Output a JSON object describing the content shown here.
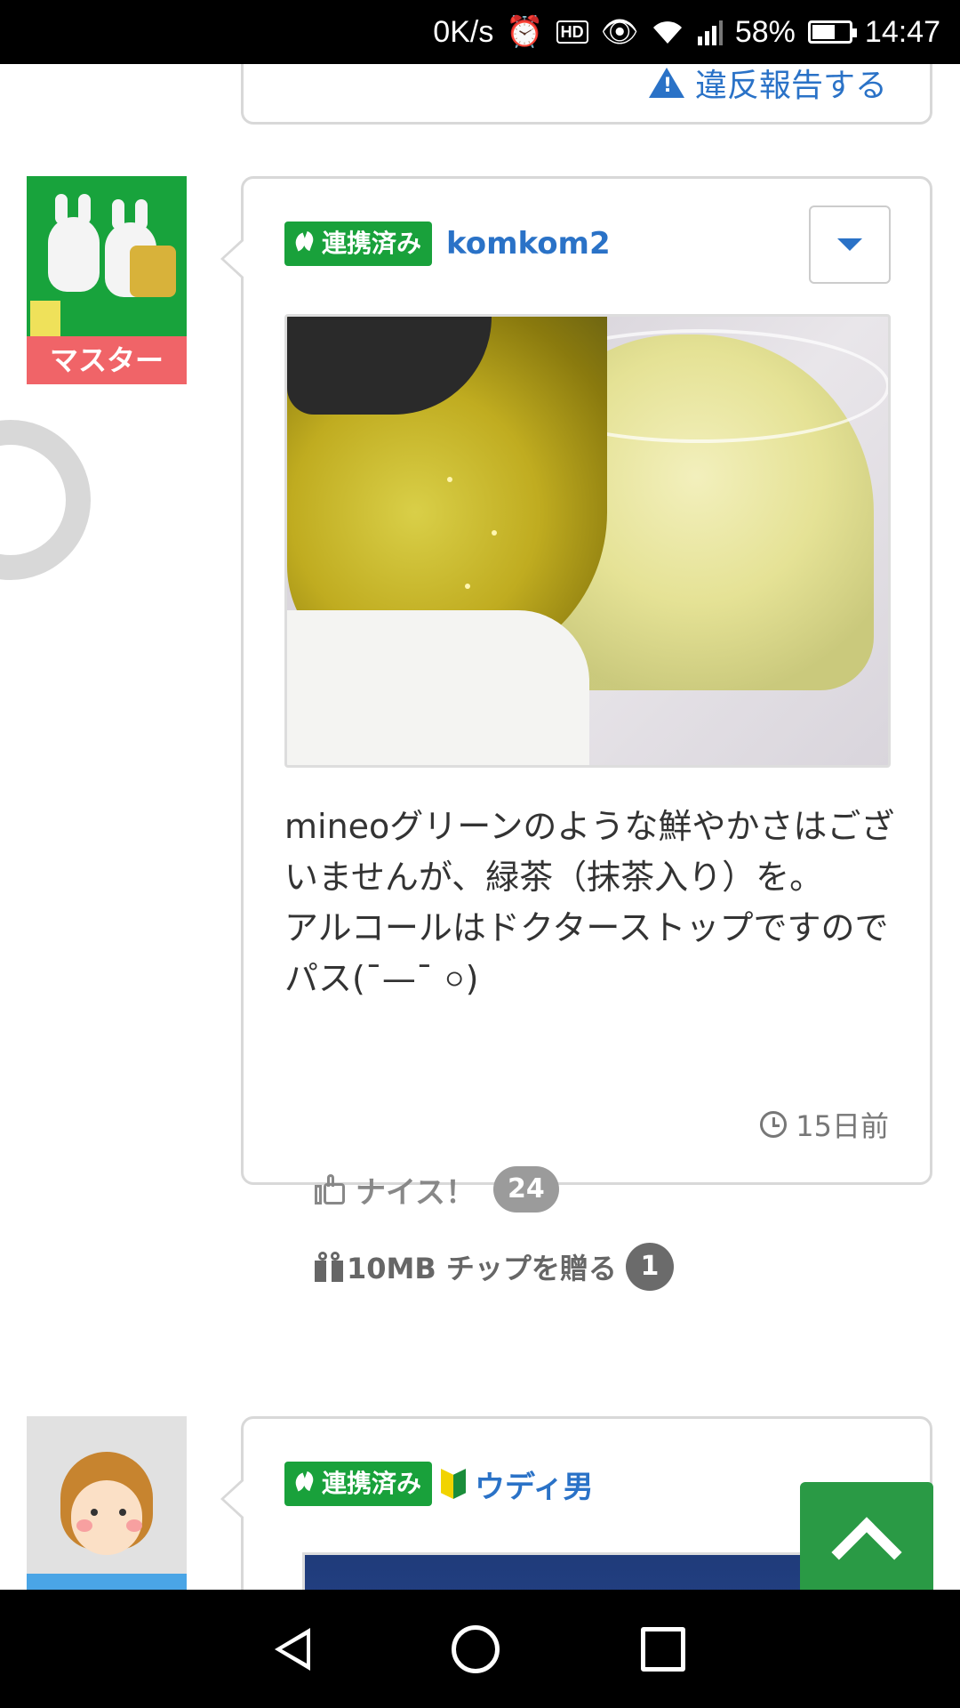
{
  "status_bar": {
    "net_speed": "0K/s",
    "hd": "HD",
    "battery": "58%",
    "battery_level": 0.58,
    "time": "14:47"
  },
  "top_card": {
    "report_link": "違反報告する"
  },
  "post": {
    "rank": "マスター",
    "linked_badge": "連携済み",
    "username": "komkom2",
    "body": "mineoグリーンのような鮮やかさはございませんが、緑茶（抹茶入り）を。\nアルコールはドクターストップですのでパス(¯—¯ ০)",
    "time_ago": "15日前",
    "nice_label": "ナイス！",
    "nice_count": "24",
    "tip_label": "10MB チップを贈る",
    "tip_count": "1"
  },
  "next_post": {
    "linked_badge": "連携済み",
    "username": "ウディ男"
  },
  "colors": {
    "brand_green": "#19a13b",
    "link_blue": "#2a72c7",
    "rank_red": "#f06468"
  }
}
